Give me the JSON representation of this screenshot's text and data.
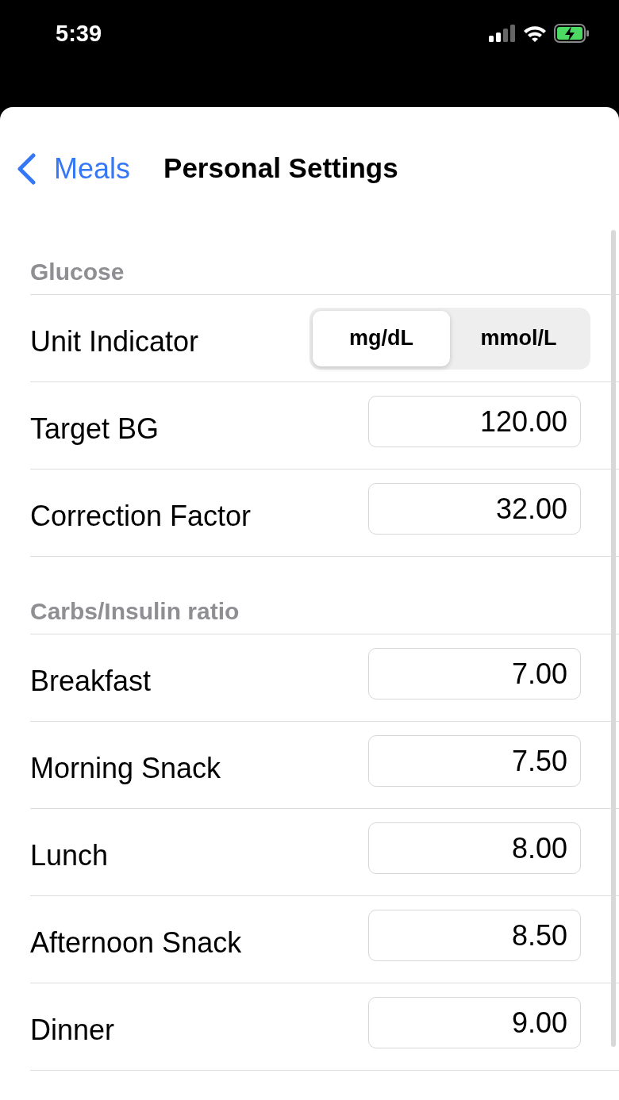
{
  "status_bar": {
    "time": "5:39"
  },
  "nav": {
    "back": "Meals",
    "title": "Personal Settings"
  },
  "sections": [
    {
      "title": "Glucose",
      "rows": [
        {
          "kind": "segmented",
          "label": "Unit Indicator",
          "options": [
            {
              "label": "mg/dL",
              "selected": true
            },
            {
              "label": "mmol/L",
              "selected": false
            }
          ]
        },
        {
          "kind": "field",
          "label": "Target BG",
          "value": "120.00"
        },
        {
          "kind": "field",
          "label": "Correction Factor",
          "value": "32.00"
        }
      ]
    },
    {
      "title": "Carbs/Insulin ratio",
      "rows": [
        {
          "kind": "field",
          "label": "Breakfast",
          "value": "7.00"
        },
        {
          "kind": "field",
          "label": "Morning Snack",
          "value": "7.50"
        },
        {
          "kind": "field",
          "label": "Lunch",
          "value": "8.00"
        },
        {
          "kind": "field",
          "label": "Afternoon Snack",
          "value": "8.50"
        },
        {
          "kind": "field",
          "label": "Dinner",
          "value": "9.00"
        }
      ]
    }
  ]
}
